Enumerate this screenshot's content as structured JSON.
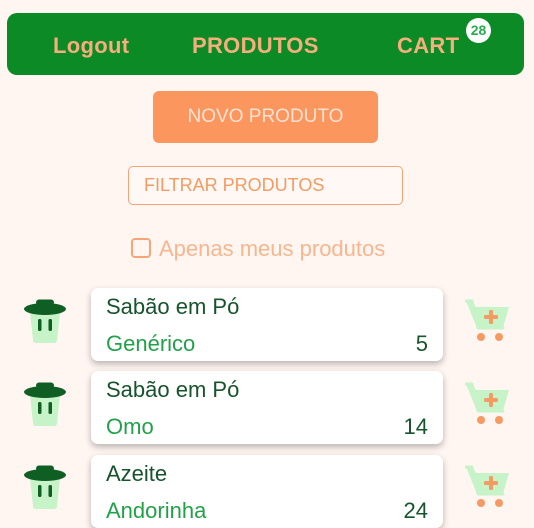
{
  "nav": {
    "logout": "Logout",
    "produtos": "PRODUTOS",
    "cart": "CART",
    "cart_count": "28"
  },
  "actions": {
    "novo_produto": "NOVO PRODUTO"
  },
  "filter": {
    "placeholder": "FILTRAR PRODUTOS",
    "value": ""
  },
  "only_mine": {
    "label": "Apenas meus produtos",
    "checked": false
  },
  "products": [
    {
      "name": "Sabão em Pó",
      "brand": "Genérico",
      "quantity": "5"
    },
    {
      "name": "Sabão em Pó",
      "brand": "Omo",
      "quantity": "14"
    },
    {
      "name": "Azeite",
      "brand": "Andorinha",
      "quantity": "24"
    }
  ],
  "icons": {
    "delete": "trash-icon",
    "add_to_cart": "cart-plus-icon"
  },
  "colors": {
    "header_bg": "#0b8a26",
    "accent_orange": "#fb965f",
    "nav_text": "#f6ae7c",
    "product_name": "#17532d",
    "product_brand": "#23a14a",
    "page_bg": "#fff6f2"
  }
}
